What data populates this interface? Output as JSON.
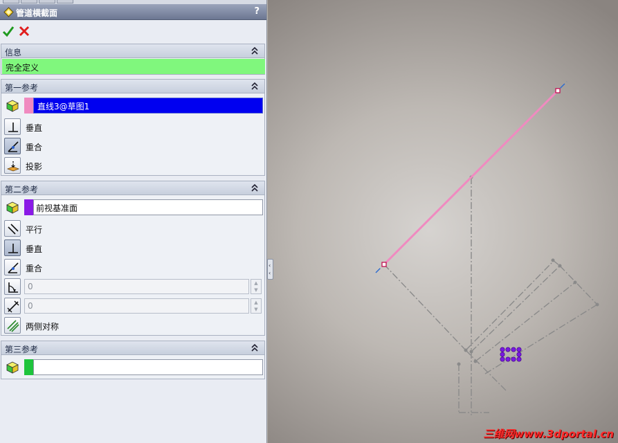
{
  "panel": {
    "title": "管道横截面",
    "help_label": "?"
  },
  "sections": {
    "info": {
      "header": "信息",
      "status": "完全定义"
    },
    "ref1": {
      "header": "第一参考",
      "field_value": "直线3@草图1",
      "chip_color": "#f08ac0",
      "options": [
        "垂直",
        "重合",
        "投影"
      ]
    },
    "ref2": {
      "header": "第二参考",
      "field_value": "前视基准面",
      "chip_color": "#8a1ae6",
      "options": [
        "平行",
        "垂直",
        "重合"
      ],
      "angle_value": "0",
      "distance_value": "0",
      "symmetric_label": "两侧对称"
    },
    "ref3": {
      "header": "第三参考",
      "field_value": "",
      "chip_color": "#1ec43c"
    }
  },
  "icons": {
    "title": "diamond-icon",
    "confirm": "checkmark-icon",
    "cancel": "cross-icon",
    "collapse": "double-chevron-up-icon",
    "entity": "cube-icon",
    "perpendicular": "perpendicular-icon",
    "coincident": "coincident-icon",
    "projection": "projection-icon",
    "parallel": "parallel-icon",
    "angle": "angle-icon",
    "distance": "distance-icon",
    "symmetric": "symmetric-icon"
  },
  "viewport": {
    "watermark": "三维网www.3dportal.cn",
    "line_color": "#f08ac0",
    "axis_color": "#2a6ad0",
    "marker_color": "#7a1ae0"
  }
}
